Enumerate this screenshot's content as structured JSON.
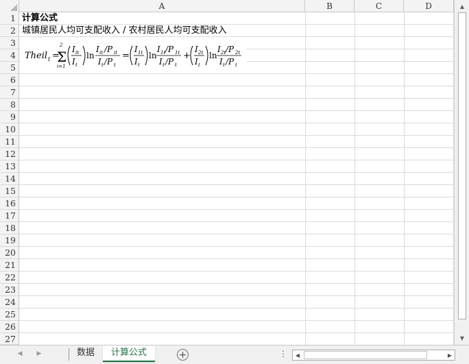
{
  "columns": [
    "A",
    "B",
    "C",
    "D"
  ],
  "rows": [
    "1",
    "2",
    "3",
    "4",
    "5",
    "6",
    "7",
    "8",
    "9",
    "10",
    "11",
    "12",
    "13",
    "14",
    "15",
    "16",
    "17",
    "18",
    "19",
    "20",
    "21",
    "22",
    "23",
    "24",
    "25",
    "26",
    "27"
  ],
  "cells": {
    "a1": "计算公式",
    "a2": "城镇居民人均可支配收入  /  农村居民人均可支配收入"
  },
  "formula": {
    "lhs": "Theil",
    "lhs_sub": "t",
    "sum_top": "2",
    "sum_bottom": "i=1",
    "ln": "ln"
  },
  "sheets": {
    "tabs": [
      {
        "label": "数据",
        "active": false
      },
      {
        "label": "计算公式",
        "active": true
      }
    ]
  },
  "icons": {
    "nav_prev": "chevron-left-icon",
    "nav_next": "chevron-right-icon",
    "add_sheet": "plus-circle-icon",
    "scroll_up": "triangle-up-icon",
    "scroll_down": "triangle-down-icon",
    "scroll_left": "triangle-left-icon",
    "scroll_right": "triangle-right-icon"
  },
  "colors": {
    "active_tab": "#217346",
    "grid_line": "#d9d9d9",
    "header_bg": "#f3f3f3"
  }
}
